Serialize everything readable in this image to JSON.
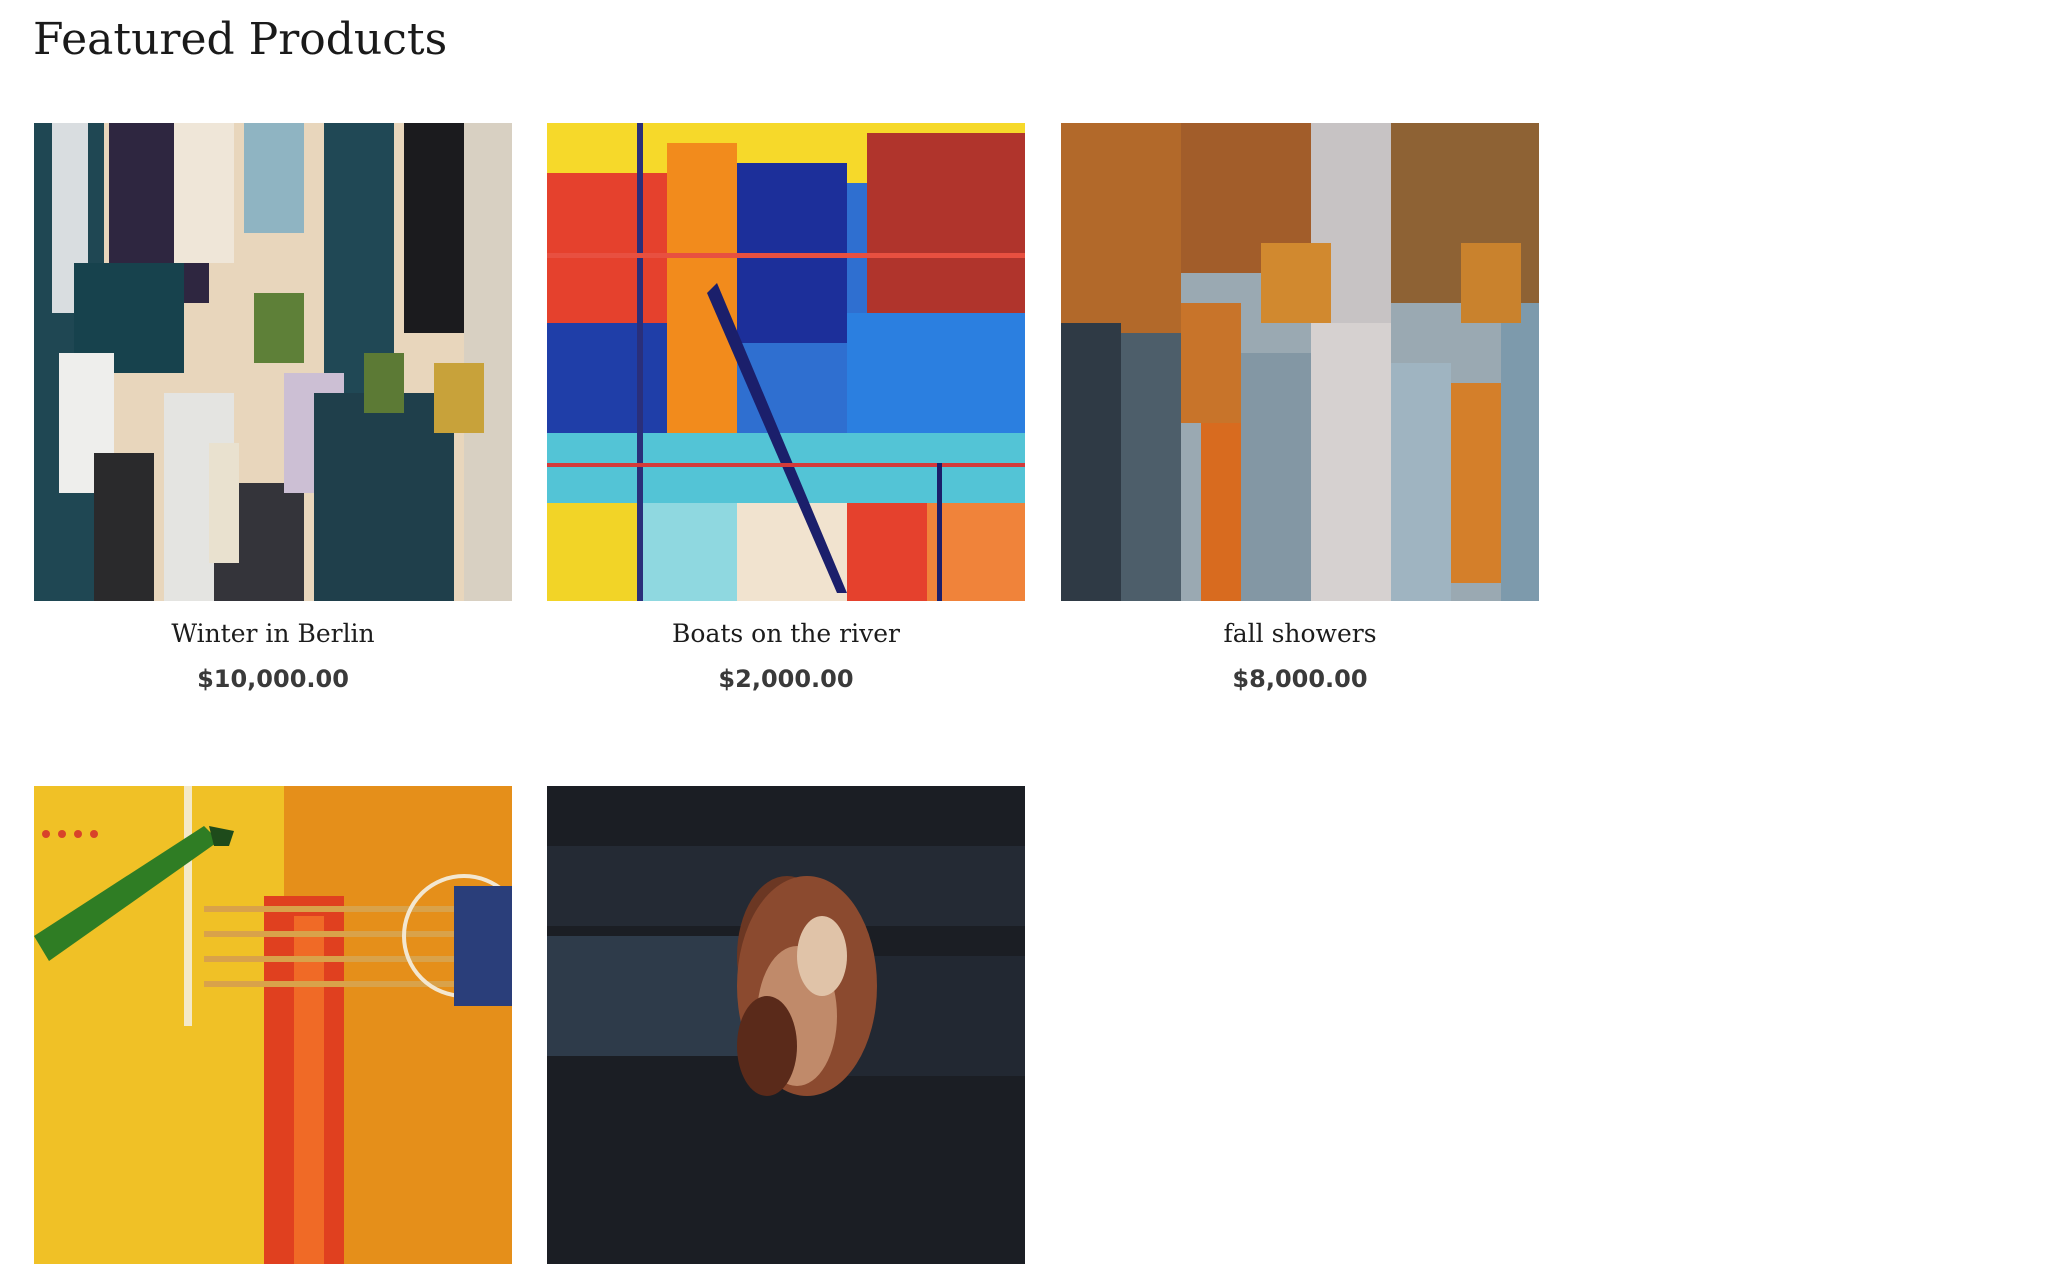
{
  "section": {
    "title": "Featured Products"
  },
  "products": [
    {
      "name": "Winter in Berlin",
      "price": "$10,000.00"
    },
    {
      "name": "Boats on the river",
      "price": "$2,000.00"
    },
    {
      "name": "fall showers",
      "price": "$8,000.00"
    },
    {
      "name": "",
      "price": ""
    },
    {
      "name": "",
      "price": ""
    }
  ]
}
